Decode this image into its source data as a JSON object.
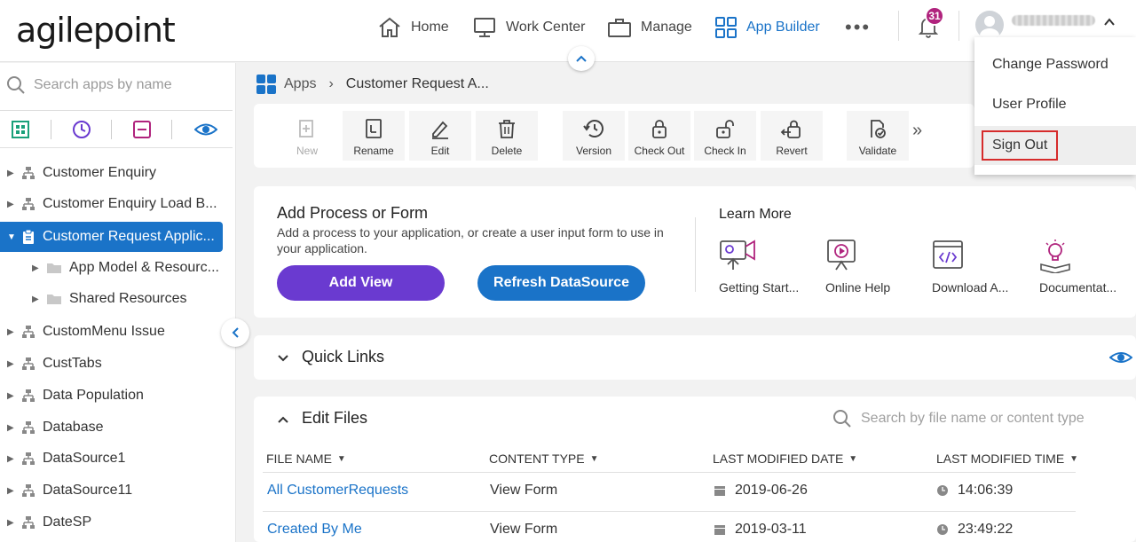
{
  "header": {
    "logo": "agilepoint",
    "nav": [
      {
        "label": "Home"
      },
      {
        "label": "Work Center"
      },
      {
        "label": "Manage"
      },
      {
        "label": "App Builder"
      }
    ],
    "more": "•••",
    "notification_count": "31"
  },
  "user_menu": {
    "items": [
      "Change Password",
      "User Profile",
      "Sign Out"
    ]
  },
  "sidebar": {
    "search_placeholder": "Search apps by name",
    "tree": [
      {
        "label": "Customer Enquiry"
      },
      {
        "label": "Customer Enquiry Load B..."
      },
      {
        "label": "Customer Request Applic..."
      },
      {
        "label": "App Model & Resourc..."
      },
      {
        "label": "Shared Resources"
      },
      {
        "label": "CustomMenu Issue"
      },
      {
        "label": "CustTabs"
      },
      {
        "label": "Data Population"
      },
      {
        "label": "Database"
      },
      {
        "label": "DataSource1"
      },
      {
        "label": "DataSource11"
      },
      {
        "label": "DateSP"
      }
    ]
  },
  "breadcrumb": {
    "root": "Apps",
    "current": "Customer Request A..."
  },
  "toolbar": {
    "buttons": [
      "New",
      "Rename",
      "Edit",
      "Delete",
      "Version",
      "Check Out",
      "Check In",
      "Revert",
      "Validate"
    ],
    "more": "»"
  },
  "add_card": {
    "title": "Add Process or Form",
    "description": "Add a process to your application, or create a user input form to use in your application.",
    "add_view": "Add View",
    "refresh": "Refresh DataSource",
    "learn_more": "Learn More",
    "learn_items": [
      "Getting Start...",
      "Online Help",
      "Download A...",
      "Documentat..."
    ]
  },
  "quick_links": {
    "title": "Quick Links"
  },
  "edit_files": {
    "title": "Edit Files",
    "search_placeholder": "Search by file name or content type",
    "columns": [
      "FILE NAME",
      "CONTENT TYPE",
      "LAST MODIFIED DATE",
      "LAST MODIFIED TIME"
    ],
    "rows": [
      {
        "name": "All CustomerRequests",
        "type": "View Form",
        "date": "2019-06-26",
        "time": "14:06:39"
      },
      {
        "name": "Created By Me",
        "type": "View Form",
        "date": "2019-03-11",
        "time": "23:49:22"
      }
    ]
  },
  "colors": {
    "accent": "#1a73c8",
    "purple": "#6a3ad0",
    "badge": "#b0237d",
    "highlight": "#d62b2b"
  }
}
